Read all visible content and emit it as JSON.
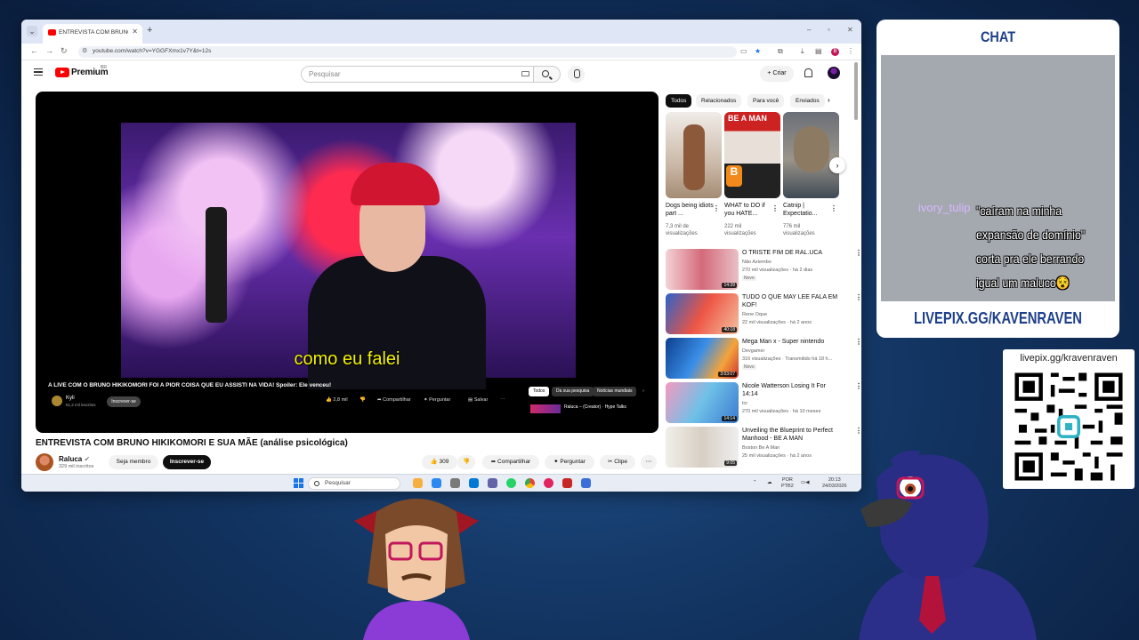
{
  "browser": {
    "tab_title": "ENTREVISTA COM BRUNO HIKI...",
    "url": "youtube.com/watch?v=YGGFXmx1v7Y&t=12s"
  },
  "youtube": {
    "brand": "Premium",
    "brand_sup": "BR",
    "search_placeholder": "Pesquisar",
    "create_label": "Criar"
  },
  "player": {
    "subtitle": "como eu falei",
    "overlay": {
      "title": "A LIVE COM O BRUNO HIKIKOMORI FOI A PIOR COISA QUE EU ASSISTI NA VIDA! Spoiler: Ele venceu!",
      "channel": "Kyli",
      "subs": "51,2 mil inscritos",
      "subscribe": "Inscrever-se",
      "likes": "2,8 mil",
      "share": "Compartilhar",
      "ask": "Perguntar",
      "save": "Salvar",
      "chips": [
        "Todos",
        "Da sua pesquisa",
        "Notícias mundiais"
      ],
      "related": "Raluca – (Creator) · Hype Talks"
    }
  },
  "video": {
    "title": "ENTREVISTA COM BRUNO HIKIKOMORI E SUA MÃE (análise psicológica)",
    "channel": "Raluca",
    "subs": "329 mil inscritos",
    "join": "Seja membro",
    "subscribe": "Inscrever-se",
    "likes": "309",
    "share": "Compartilhar",
    "ask": "Perguntar",
    "clip": "Clipe"
  },
  "sidebar": {
    "chips": [
      "Todos",
      "Relacionados",
      "Para você",
      "Enviados"
    ],
    "shorts": [
      {
        "title": "Dogs being idiots part ...",
        "views": "7,3 mil de visualizações"
      },
      {
        "title": "WHAT to DO if you HATE...",
        "views": "222 mil visualizações"
      },
      {
        "title": "Catnip | Expectatio...",
        "views": "776 mil visualizações"
      }
    ],
    "videos": [
      {
        "title": "O TRISTE FIM DE RAL.UCA",
        "channel": "Não Aziembo",
        "meta": "270 mil visualizações · há 2 dias",
        "badge": "Novo",
        "duration": "14:39"
      },
      {
        "title": "TUDO O QUE MAY LEE FALA EM KOF!",
        "channel": "Rene Oque",
        "meta": "22 mil visualizações · há 2 anos",
        "badge": "",
        "duration": "40:18"
      },
      {
        "title": "Mega Man x - Super nintendo",
        "channel": "Devgamer",
        "meta": "316 visualizações · Transmitido há 18 h...",
        "badge": "Novo",
        "duration": "3:03:07"
      },
      {
        "title": "Nicole Watterson Losing It For 14:14",
        "channel": "tcr",
        "meta": "270 mil visualizações · há 10 meses",
        "badge": "",
        "duration": "14:14"
      },
      {
        "title": "Unveiling the Blueprint to Perfect Manhood - BE A MAN",
        "channel": "Boston Be A Man",
        "meta": "25 mil visualizações · há 2 anos",
        "badge": "",
        "duration": "9:05"
      }
    ]
  },
  "taskbar": {
    "search": "Pesquisar",
    "lang": "POR",
    "layout": "PTB2",
    "time": "20:13",
    "date": "24/03/2026"
  },
  "chat": {
    "title": "CHAT",
    "user": "ivory_tulip",
    "message": "\"caíram na minha expansão de domínio\" corta pra ele berrando igual um maluco",
    "emoji": "😵",
    "footer": "LIVEPIX.GG/KAVENRAVEN"
  },
  "qr": {
    "label": "livepix.gg/kravenraven"
  },
  "colors": {
    "accent_red": "#ff0000",
    "chat_blue": "#1e3f8a",
    "subtitle_yellow": "#f2f200"
  }
}
